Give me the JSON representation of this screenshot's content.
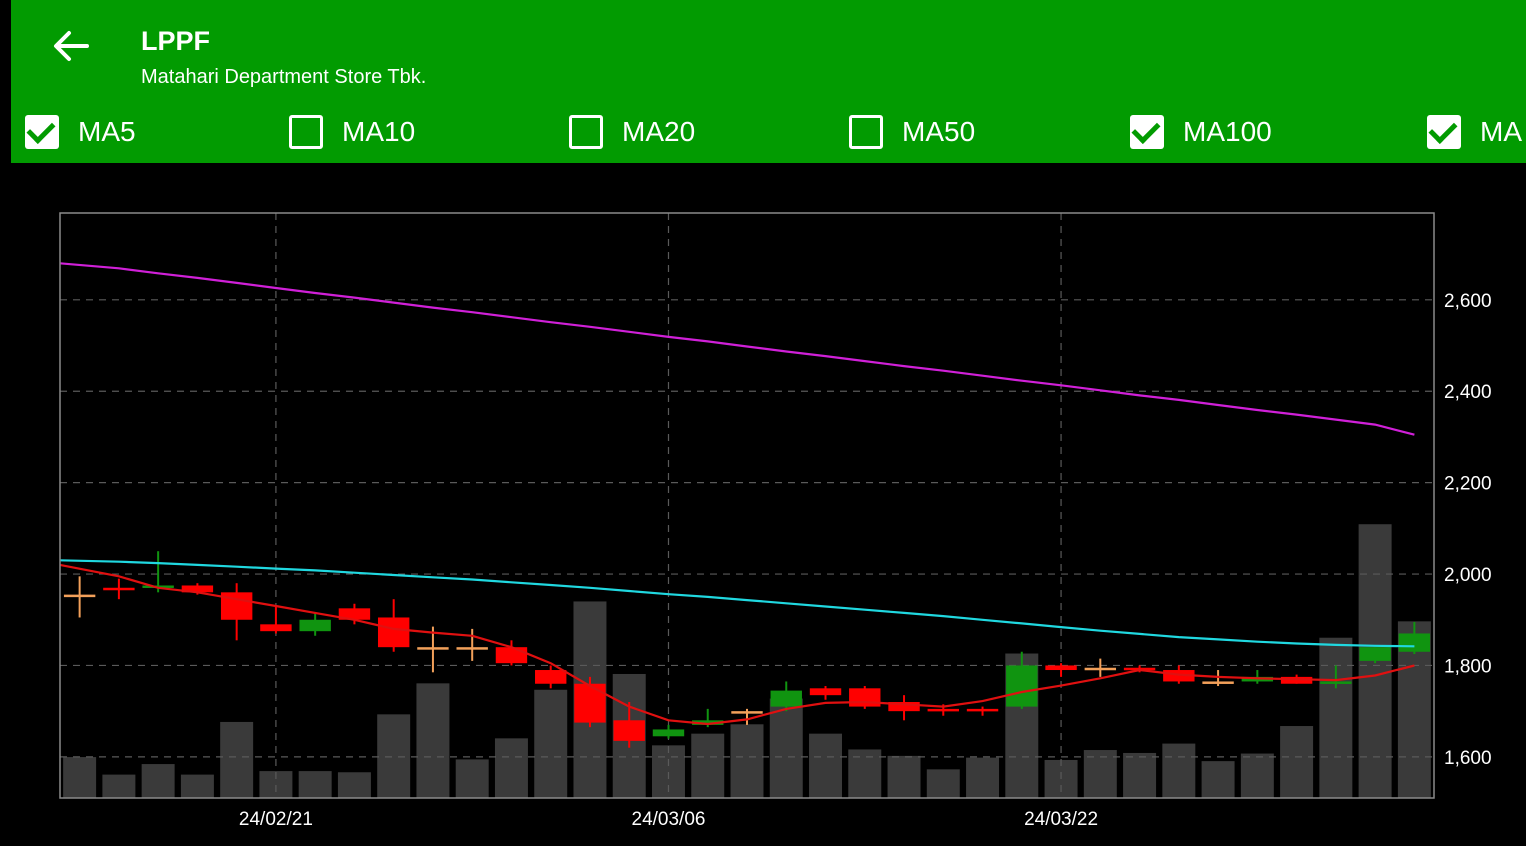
{
  "header": {
    "ticker": "LPPF",
    "company": "Matahari Department Store Tbk.",
    "back_icon": "arrow-left-icon",
    "background": "#029b01"
  },
  "ma_toggles": [
    {
      "label": "MA5",
      "checked": true
    },
    {
      "label": "MA10",
      "checked": false
    },
    {
      "label": "MA20",
      "checked": false
    },
    {
      "label": "MA50",
      "checked": false
    },
    {
      "label": "MA100",
      "checked": true
    },
    {
      "label": "MA",
      "checked": true
    }
  ],
  "chart_data": {
    "type": "candlestick",
    "ylim": [
      1510,
      2790
    ],
    "y_ticks": [
      "1,600",
      "1,800",
      "2,000",
      "2,200",
      "2,400",
      "2,600"
    ],
    "x_ticks": [
      "24/02/21",
      "24/03/06",
      "24/03/22"
    ],
    "grid": true,
    "colors": {
      "up": "#109410",
      "down": "#ff0000",
      "flat": "#f2a05a",
      "volume": "#3a3a3a",
      "ma5": "#e01010",
      "ma100": "#20d8e0",
      "ma_long": "#d020d8"
    },
    "candles": [
      {
        "open": 1955,
        "high": 1995,
        "low": 1905,
        "close": 1955
      },
      {
        "open": 1970,
        "high": 1990,
        "low": 1945,
        "close": 1965
      },
      {
        "open": 1970,
        "high": 2050,
        "low": 1960,
        "close": 1975
      },
      {
        "open": 1975,
        "high": 1980,
        "low": 1955,
        "close": 1960
      },
      {
        "open": 1960,
        "high": 1980,
        "low": 1855,
        "close": 1900
      },
      {
        "open": 1890,
        "high": 1930,
        "low": 1870,
        "close": 1875
      },
      {
        "open": 1875,
        "high": 1915,
        "low": 1865,
        "close": 1900
      },
      {
        "open": 1925,
        "high": 1935,
        "low": 1890,
        "close": 1900
      },
      {
        "open": 1905,
        "high": 1945,
        "low": 1830,
        "close": 1840
      },
      {
        "open": 1840,
        "high": 1885,
        "low": 1785,
        "close": 1840
      },
      {
        "open": 1840,
        "high": 1880,
        "low": 1810,
        "close": 1840
      },
      {
        "open": 1840,
        "high": 1855,
        "low": 1800,
        "close": 1805
      },
      {
        "open": 1790,
        "high": 1800,
        "low": 1750,
        "close": 1760
      },
      {
        "open": 1760,
        "high": 1775,
        "low": 1665,
        "close": 1675
      },
      {
        "open": 1680,
        "high": 1720,
        "low": 1620,
        "close": 1635
      },
      {
        "open": 1645,
        "high": 1670,
        "low": 1640,
        "close": 1660
      },
      {
        "open": 1670,
        "high": 1705,
        "low": 1665,
        "close": 1680
      },
      {
        "open": 1700,
        "high": 1705,
        "low": 1670,
        "close": 1700
      },
      {
        "open": 1710,
        "high": 1765,
        "low": 1700,
        "close": 1745
      },
      {
        "open": 1750,
        "high": 1755,
        "low": 1725,
        "close": 1735
      },
      {
        "open": 1750,
        "high": 1755,
        "low": 1705,
        "close": 1710
      },
      {
        "open": 1720,
        "high": 1735,
        "low": 1680,
        "close": 1700
      },
      {
        "open": 1705,
        "high": 1715,
        "low": 1690,
        "close": 1700
      },
      {
        "open": 1705,
        "high": 1710,
        "low": 1690,
        "close": 1700
      },
      {
        "open": 1710,
        "high": 1830,
        "low": 1705,
        "close": 1800
      },
      {
        "open": 1800,
        "high": 1805,
        "low": 1775,
        "close": 1790
      },
      {
        "open": 1795,
        "high": 1815,
        "low": 1775,
        "close": 1795
      },
      {
        "open": 1795,
        "high": 1800,
        "low": 1785,
        "close": 1790
      },
      {
        "open": 1790,
        "high": 1800,
        "low": 1760,
        "close": 1765
      },
      {
        "open": 1765,
        "high": 1790,
        "low": 1755,
        "close": 1765
      },
      {
        "open": 1765,
        "high": 1790,
        "low": 1760,
        "close": 1775
      },
      {
        "open": 1775,
        "high": 1780,
        "low": 1760,
        "close": 1760
      },
      {
        "open": 1760,
        "high": 1800,
        "low": 1750,
        "close": 1765
      },
      {
        "open": 1810,
        "high": 1840,
        "low": 1805,
        "close": 1840
      },
      {
        "open": 1830,
        "high": 1895,
        "low": 1825,
        "close": 1870
      }
    ],
    "volumes": [
      0.07,
      0.04,
      0.058,
      0.04,
      0.13,
      0.046,
      0.046,
      0.044,
      0.143,
      0.196,
      0.066,
      0.102,
      0.185,
      0.336,
      0.212,
      0.09,
      0.11,
      0.126,
      0.17,
      0.11,
      0.083,
      0.072,
      0.049,
      0.069,
      0.247,
      0.065,
      0.082,
      0.077,
      0.093,
      0.063,
      0.076,
      0.123,
      0.274,
      0.468,
      0.302
    ],
    "ma5": [
      2020,
      1995,
      1970,
      1960,
      1945,
      1930,
      1915,
      1900,
      1880,
      1872,
      1865,
      1840,
      1805,
      1755,
      1710,
      1680,
      1672,
      1682,
      1705,
      1718,
      1720,
      1715,
      1710,
      1722,
      1742,
      1756,
      1772,
      1790,
      1780,
      1775,
      1772,
      1770,
      1768,
      1778,
      1800
    ],
    "ma100": [
      2030,
      2027,
      2024,
      2020,
      2016,
      2012,
      2008,
      2003,
      1998,
      1993,
      1988,
      1982,
      1976,
      1970,
      1963,
      1956,
      1950,
      1943,
      1936,
      1929,
      1922,
      1915,
      1908,
      1900,
      1892,
      1884,
      1876,
      1869,
      1862,
      1857,
      1852,
      1848,
      1845,
      1843,
      1842
    ],
    "ma_long": [
      2680,
      2669,
      2658,
      2648,
      2637,
      2626,
      2615,
      2605,
      2594,
      2583,
      2573,
      2562,
      2551,
      2541,
      2530,
      2519,
      2509,
      2498,
      2487,
      2477,
      2466,
      2455,
      2445,
      2434,
      2423,
      2413,
      2402,
      2391,
      2381,
      2370,
      2359,
      2349,
      2338,
      2327,
      2305
    ]
  }
}
